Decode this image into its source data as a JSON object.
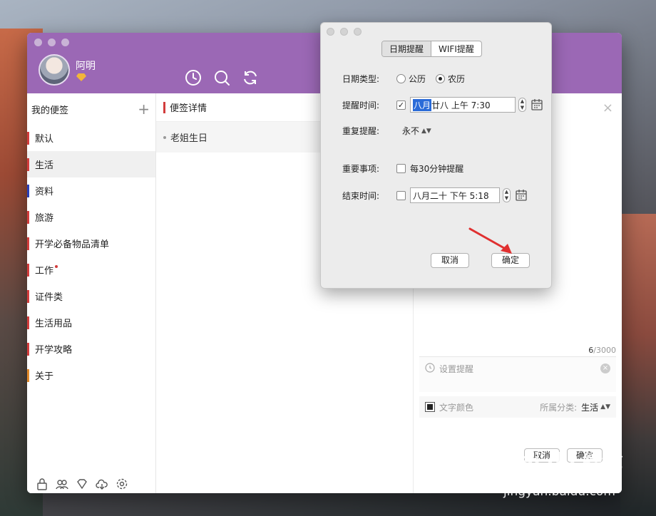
{
  "user": {
    "name": "阿明"
  },
  "toolbar": {
    "icons": [
      "clock-icon",
      "search-icon",
      "sync-icon"
    ]
  },
  "sidebar": {
    "title": "我的便签",
    "add_label": "+",
    "items": [
      {
        "label": "默认",
        "color": "#d23c3c",
        "active": false,
        "dot": false
      },
      {
        "label": "生活",
        "color": "#d23c3c",
        "active": true,
        "dot": false
      },
      {
        "label": "资料",
        "color": "#2a3fb8",
        "active": false,
        "dot": false
      },
      {
        "label": "旅游",
        "color": "#d23c3c",
        "active": false,
        "dot": false
      },
      {
        "label": "开学必备物品清单",
        "color": "#d23c3c",
        "active": false,
        "dot": false
      },
      {
        "label": "工作",
        "color": "#d23c3c",
        "active": false,
        "dot": true
      },
      {
        "label": "证件类",
        "color": "#d23c3c",
        "active": false,
        "dot": false
      },
      {
        "label": "生活用品",
        "color": "#d23c3c",
        "active": false,
        "dot": false
      },
      {
        "label": "开学攻略",
        "color": "#d23c3c",
        "active": false,
        "dot": false
      },
      {
        "label": "关于",
        "color": "#e0892a",
        "active": false,
        "dot": false
      }
    ],
    "bottom_icons": [
      "lock-icon",
      "friends-icon",
      "diamond-icon",
      "cloud-download-icon",
      "settings-icon"
    ]
  },
  "notes": {
    "header": "便签详情",
    "items": [
      "老姐生日"
    ]
  },
  "editor": {
    "close": "×",
    "char_count": "6",
    "char_max": "/3000",
    "reminder_label": "设置提醒",
    "text_color_label": "文字颜色",
    "category_label": "所属分类:",
    "category_value": "生活",
    "cancel": "取消",
    "ok": "确定"
  },
  "dialog": {
    "tabs": [
      "日期提醒",
      "WIFI提醒"
    ],
    "date_type_label": "日期类型:",
    "date_type_options": [
      "公历",
      "农历"
    ],
    "date_type_selected": 1,
    "remind_time_label": "提醒时间:",
    "remind_time_checked": true,
    "remind_time_highlight": "八月",
    "remind_time_rest": "廿八 上午  7:30",
    "repeat_label": "重复提醒:",
    "repeat_value": "永不",
    "important_label": "重要事项:",
    "important_option": "每30分钟提醒",
    "end_time_label": "结束时间:",
    "end_time_value": "八月二十 下午  5:18",
    "cancel": "取消",
    "ok": "确定"
  },
  "watermark": {
    "main": "Bai du 经验",
    "sub": "jingyan.baidu.com"
  },
  "colors": {
    "titlebar": "#9b68b5",
    "accent_red": "#d23c3c",
    "arrow": "#e03030"
  }
}
